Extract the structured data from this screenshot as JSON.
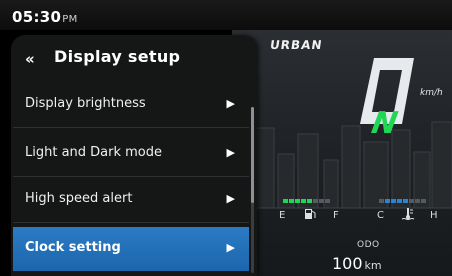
{
  "status_bar": {
    "time": "05:30",
    "period": "PM"
  },
  "menu": {
    "back_icon": "double-chevron-left-icon",
    "title": "Display setup",
    "items": [
      {
        "label": "Display brightness",
        "selected": false
      },
      {
        "label": "Light and Dark mode",
        "selected": false
      },
      {
        "label": "High speed alert",
        "selected": false
      },
      {
        "label": "Clock setting",
        "selected": true
      }
    ],
    "accent_color": "#1f6db4"
  },
  "dashboard": {
    "ride_mode": "URBAN",
    "speed": "0",
    "speed_unit": "km/h",
    "gear": "N",
    "gear_color": "#1fd655",
    "fuel_gauge": {
      "left_label": "E",
      "right_label": "F",
      "icon": "fuel-pump-icon",
      "level": 0.5,
      "color": "#1fd655"
    },
    "temp_gauge": {
      "left_label": "C",
      "right_label": "H",
      "icon": "thermometer-icon",
      "level": 0.5,
      "color": "#2b83d6"
    },
    "odo": {
      "label": "ODO",
      "value": "100",
      "unit": "km"
    }
  }
}
